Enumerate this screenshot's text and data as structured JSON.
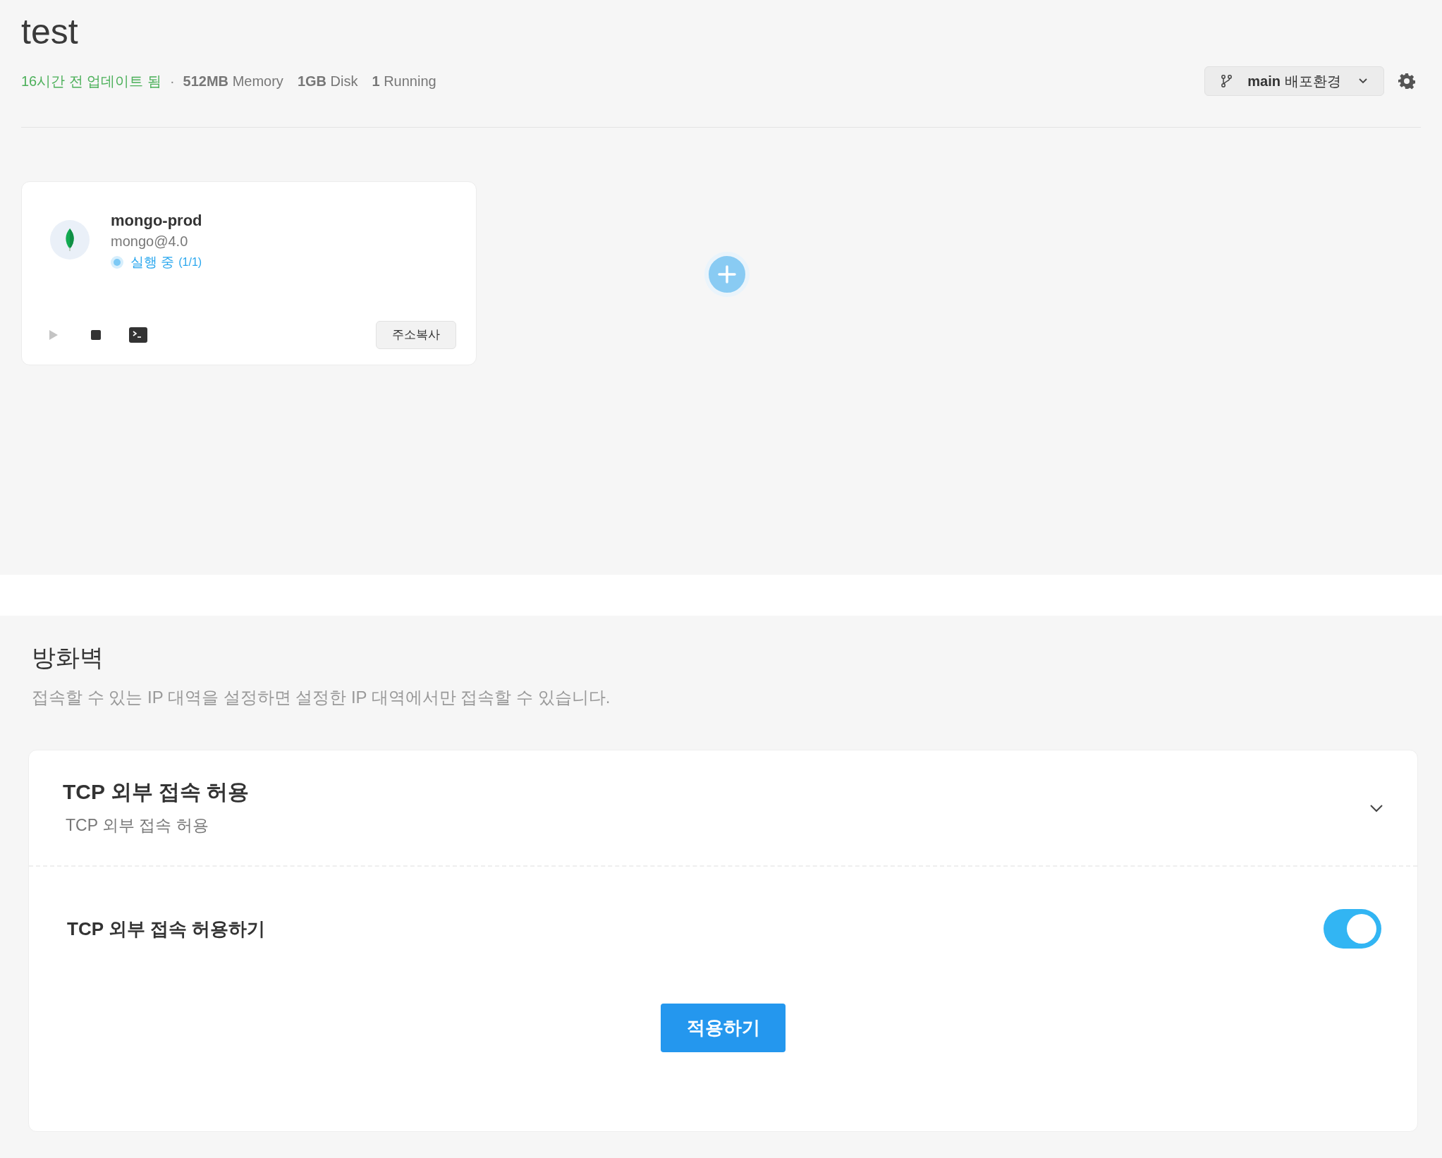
{
  "project": {
    "title": "test",
    "updated": "16시간 전 업데이트 됨",
    "separator": "·",
    "stats": [
      "**512MB** Memory",
      "**1GB** Disk",
      "**1** Running"
    ]
  },
  "env_selector": {
    "branch": "main",
    "label": "배포환경"
  },
  "services": [
    {
      "name": "mongo-prod",
      "image": "mongo@4.0",
      "status": "실행 중",
      "count": "(1/1)",
      "controls": [
        {
          "kind": "play",
          "disabled": true
        },
        {
          "kind": "stop",
          "disabled": false
        },
        {
          "kind": "terminal",
          "disabled": false
        }
      ],
      "copy_button": "주소복사"
    }
  ],
  "firewall": {
    "title": "방화벽",
    "description": "접속할 수 있는 IP 대역을 설정하면 설정한 IP 대역에서만 접속할 수 있습니다.",
    "panel": {
      "title": "TCP 외부 접속 허용",
      "subtitle": "TCP 외부 접속 허용",
      "option": {
        "label": "TCP 외부 접속 허용하기",
        "on": true
      },
      "apply_button": "적용하기"
    }
  }
}
